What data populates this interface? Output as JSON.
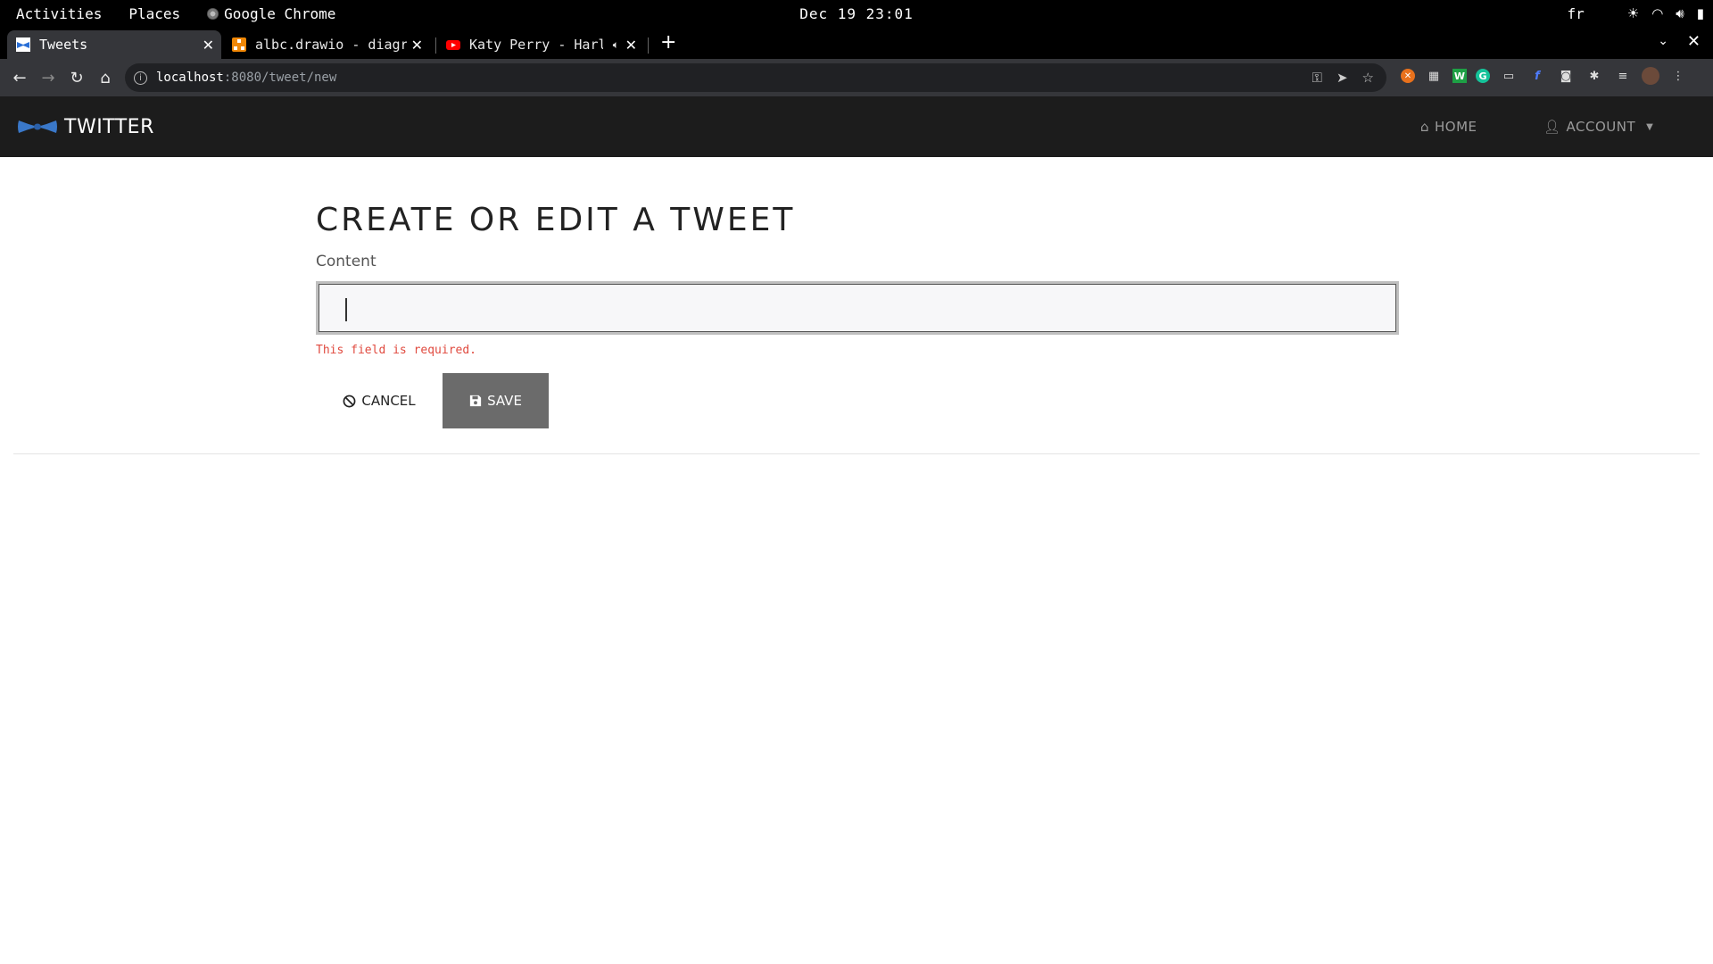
{
  "os": {
    "activities": "Activities",
    "places": "Places",
    "app_name": "Google Chrome",
    "clock": "Dec 19 23:01",
    "lang": "fr"
  },
  "browser": {
    "tabs": [
      {
        "title": "Tweets"
      },
      {
        "title": "albc.drawio - diagr"
      },
      {
        "title": "Katy Perry - Harl"
      }
    ],
    "url_host": "localhost",
    "url_path": ":8080/tweet/new"
  },
  "app": {
    "brand": "TWITTER",
    "nav": {
      "home": "HOME",
      "account": "ACCOUNT"
    }
  },
  "form": {
    "title": "CREATE OR EDIT A TWEET",
    "content_label": "Content",
    "content_value": "",
    "error": "This field is required.",
    "cancel_label": "CANCEL",
    "save_label": "SAVE"
  }
}
